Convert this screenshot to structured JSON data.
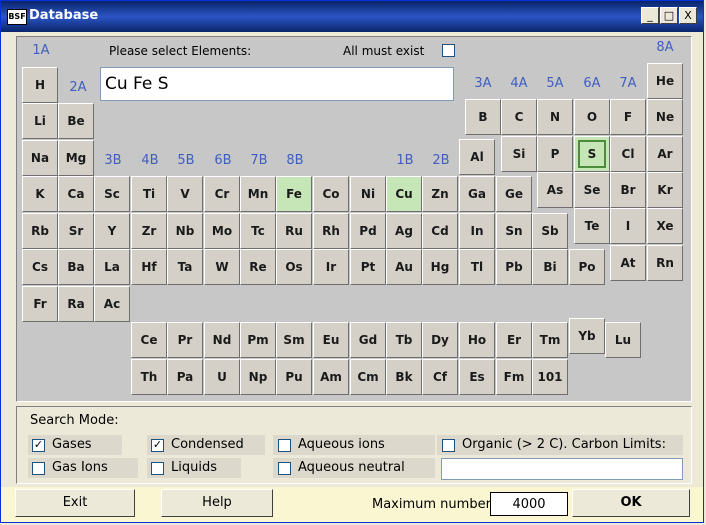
{
  "window": {
    "title": "Database",
    "icon": "BSF",
    "minimize": "_",
    "maximize": "□",
    "close": "X"
  },
  "prompt": "Please select Elements:",
  "all_must_exist": {
    "label": "All must exist",
    "checked": false
  },
  "selected_elements_text": "Cu Fe S",
  "groups": {
    "1A": "1A",
    "2A": "2A",
    "3A": "3A",
    "4A": "4A",
    "5A": "5A",
    "6A": "6A",
    "7A": "7A",
    "8A": "8A",
    "3B": "3B",
    "4B": "4B",
    "5B": "5B",
    "6B": "6B",
    "7B": "7B",
    "8B": "8B",
    "1B": "1B",
    "2B": "2B"
  },
  "elements": [
    "H",
    "He",
    "Li",
    "Be",
    "B",
    "C",
    "N",
    "O",
    "F",
    "Ne",
    "Na",
    "Mg",
    "Al",
    "Si",
    "P",
    "S",
    "Cl",
    "Ar",
    "K",
    "Ca",
    "Sc",
    "Ti",
    "V",
    "Cr",
    "Mn",
    "Fe",
    "Co",
    "Ni",
    "Cu",
    "Zn",
    "Ga",
    "Ge",
    "As",
    "Se",
    "Br",
    "Kr",
    "Rb",
    "Sr",
    "Y",
    "Zr",
    "Nb",
    "Mo",
    "Tc",
    "Ru",
    "Rh",
    "Pd",
    "Ag",
    "Cd",
    "In",
    "Sn",
    "Sb",
    "Te",
    "I",
    "Xe",
    "Cs",
    "Ba",
    "La",
    "Hf",
    "Ta",
    "W",
    "Re",
    "Os",
    "Ir",
    "Pt",
    "Au",
    "Hg",
    "Tl",
    "Pb",
    "Bi",
    "Po",
    "At",
    "Rn",
    "Fr",
    "Ra",
    "Ac",
    "Ce",
    "Pr",
    "Nd",
    "Pm",
    "Sm",
    "Eu",
    "Gd",
    "Tb",
    "Dy",
    "Ho",
    "Er",
    "Tm",
    "Yb",
    "Lu",
    "Th",
    "Pa",
    "U",
    "Np",
    "Pu",
    "Am",
    "Cm",
    "Bk",
    "Cf",
    "Es",
    "Fm",
    "101"
  ],
  "selected": [
    "Fe",
    "Cu",
    "S"
  ],
  "search_mode": {
    "title": "Search Mode:",
    "gases": {
      "label": "Gases",
      "checked": true
    },
    "condensed": {
      "label": "Condensed",
      "checked": true
    },
    "aqueous_ions": {
      "label": "Aqueous ions",
      "checked": false
    },
    "organic": {
      "label": "Organic (> 2 C). Carbon Limits:",
      "checked": false
    },
    "gas_ions": {
      "label": "Gas Ions",
      "checked": false
    },
    "liquids": {
      "label": "Liquids",
      "checked": false
    },
    "aqueous_neutral": {
      "label": "Aqueous neutral",
      "checked": false
    },
    "carbon_limits_value": ""
  },
  "buttons": {
    "exit": "Exit",
    "help": "Help",
    "ok": "OK"
  },
  "maximum_number": {
    "label": "Maximum number",
    "value": "4000"
  },
  "colors": {
    "accent": "#3f5fbf",
    "selected_fill": "#c7e6b8",
    "title_bar": "#0a246a"
  }
}
